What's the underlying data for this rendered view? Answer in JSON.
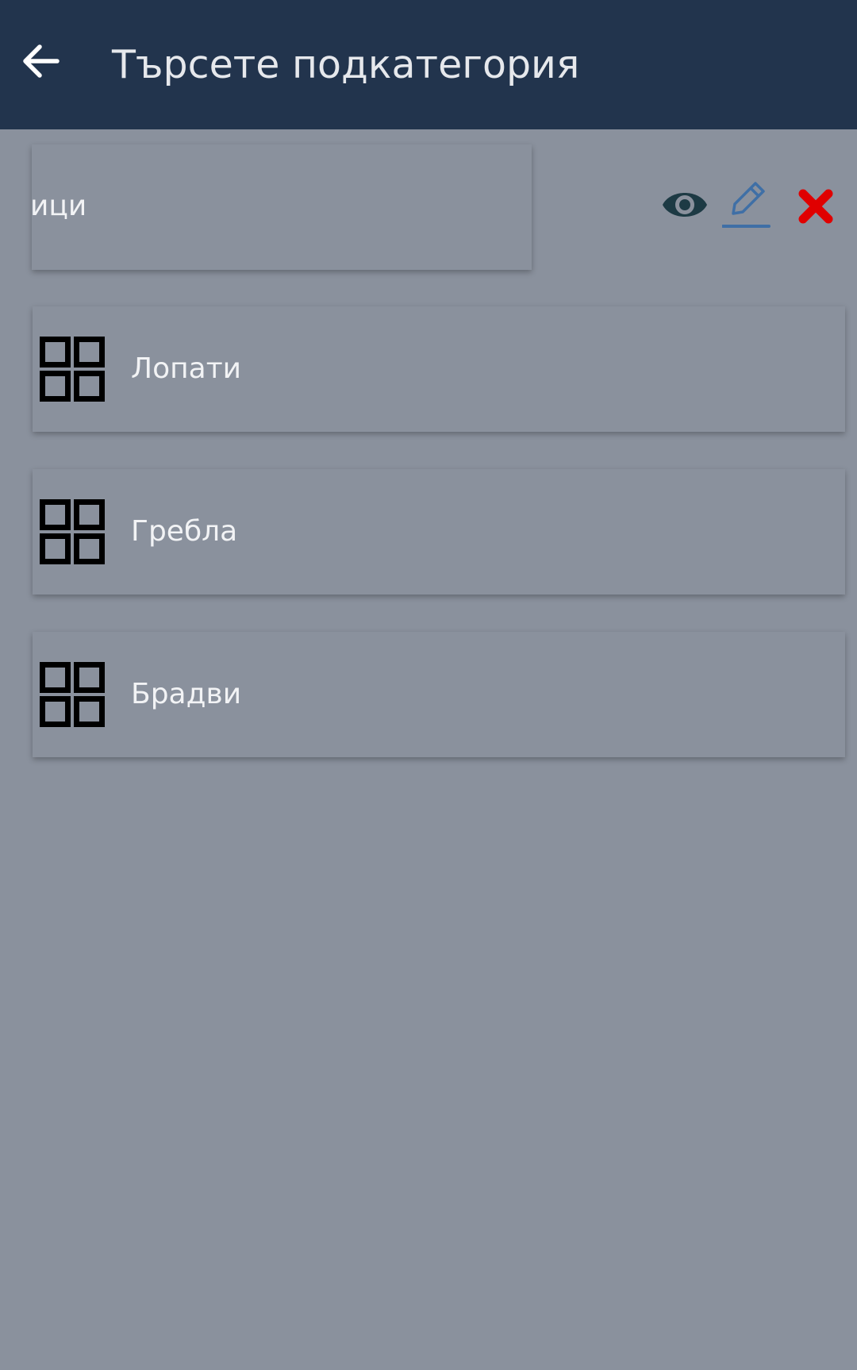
{
  "appbar": {
    "title": "Търсете подкатегория",
    "background": "#22344d"
  },
  "swiped_item": {
    "label_visible": "ици",
    "actions": [
      {
        "name": "view",
        "icon": "eye-icon",
        "color": "#1d3a44"
      },
      {
        "name": "edit",
        "icon": "pencil-icon",
        "color": "#3f6fa6"
      },
      {
        "name": "delete",
        "icon": "close-icon",
        "color": "#e00000"
      }
    ]
  },
  "items": [
    {
      "label": "Лопати",
      "icon": "grid-icon"
    },
    {
      "label": "Гребла",
      "icon": "grid-icon"
    },
    {
      "label": "Брадви",
      "icon": "grid-icon"
    }
  ],
  "colors": {
    "page_background": "#8a919d",
    "text": "#f2f3f5"
  }
}
